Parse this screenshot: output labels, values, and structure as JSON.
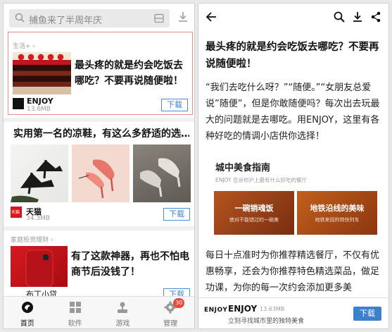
{
  "left": {
    "search": {
      "placeholder": "捕鱼来了半周年庆"
    },
    "cards": [
      {
        "category": "生活+ ›",
        "title": "最头疼的就是约会吃饭去哪吃？不要再说随便啦！",
        "brand": "ENJOY",
        "size": "13.6MB",
        "button": "下载"
      },
      {
        "title": "实用第一名的凉鞋，有这么多舒适的选…",
        "brand": "天猫",
        "size": "34.3MB",
        "button": "下载",
        "logo_text": "天猫"
      },
      {
        "category": "家庭投资理财 ›",
        "title": "有了这款神器，再也不怕电商节后没钱了！",
        "brand": "布丁小贷",
        "button": "下载"
      }
    ],
    "tabs": [
      {
        "label": "首页",
        "active": true
      },
      {
        "label": "软件"
      },
      {
        "label": "游戏"
      },
      {
        "label": "管理",
        "badge": "30"
      }
    ]
  },
  "right": {
    "title": "最头疼的就是约会吃饭去哪吃？不要再说随便啦！",
    "body1": "“我们去吃什么呀？”“随便。”“女朋友总爱说”随便”，但是你敢随便吗？每次出去玩最大的问题就是去哪吃。用ENJOY，这里有各种好吃的情调小店供你选择！",
    "guide": {
      "title": "城中美食指南",
      "subtitle": "ENJOY 告诉你沪上最有什么好吃的餐厅",
      "cards": [
        {
          "heading": "一碗销魂饭",
          "sub": "绝对不能错过的一碗美"
        },
        {
          "heading": "地铁沿线的美味",
          "sub": "地铁来回的特快列车"
        }
      ]
    },
    "body2": "每日十点准时为你推荐精选餐厅，不仅有优惠畅享，还会为你推荐特色精选菜品，做足功课，为你的每一次约会添加更多美",
    "footer": {
      "logo": "ENJOY",
      "name": "ENJOY",
      "size": "13.63MB",
      "desc": "立刻寻找城市里的独特美食",
      "button": "下载"
    }
  },
  "colors": {
    "accent": "#3a82d0",
    "highlight_border": "#f08a80",
    "badge": "#e8473a"
  }
}
